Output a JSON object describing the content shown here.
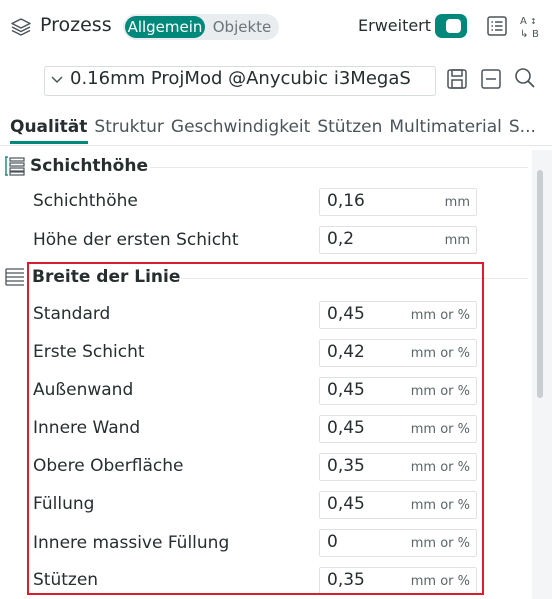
{
  "header": {
    "title": "Prozess",
    "mode_tabs": [
      {
        "label": "Allgemein",
        "active": true
      },
      {
        "label": "Objekte",
        "active": false
      }
    ],
    "advanced_label": "Erweitert",
    "advanced_enabled": true,
    "icons": [
      "layers-icon",
      "list-icon",
      "compare-icon"
    ]
  },
  "preset": {
    "value": "0.16mm ProjMod @Anycubic i3MegaS",
    "icons": [
      "chevron-down-icon",
      "save-icon",
      "minus-icon",
      "search-icon"
    ]
  },
  "tabs": [
    {
      "label": "Qualität",
      "active": true
    },
    {
      "label": "Struktur",
      "active": false
    },
    {
      "label": "Geschwindigkeit",
      "active": false
    },
    {
      "label": "Stützen",
      "active": false
    },
    {
      "label": "Multimaterial",
      "active": false
    },
    {
      "label": "S...",
      "active": false
    }
  ],
  "sections": [
    {
      "title": "Schichthöhe",
      "rows": [
        {
          "label": "Schichthöhe",
          "value": "0,16",
          "unit": "mm"
        },
        {
          "label": "Höhe der ersten Schicht",
          "value": "0,2",
          "unit": "mm"
        }
      ]
    },
    {
      "title": "Breite der Linie",
      "rows": [
        {
          "label": "Standard",
          "value": "0,45",
          "unit": "mm or %"
        },
        {
          "label": "Erste Schicht",
          "value": "0,42",
          "unit": "mm or %"
        },
        {
          "label": "Außenwand",
          "value": "0,45",
          "unit": "mm or %"
        },
        {
          "label": "Innere Wand",
          "value": "0,45",
          "unit": "mm or %"
        },
        {
          "label": "Obere Oberfläche",
          "value": "0,35",
          "unit": "mm or %"
        },
        {
          "label": "Füllung",
          "value": "0,45",
          "unit": "mm or %"
        },
        {
          "label": "Innere massive Füllung",
          "value": "0",
          "unit": "mm or %"
        },
        {
          "label": "Stützen",
          "value": "0,35",
          "unit": "mm or %"
        }
      ]
    }
  ],
  "colors": {
    "accent": "#00897b",
    "highlight_box": "#d71f2f"
  }
}
